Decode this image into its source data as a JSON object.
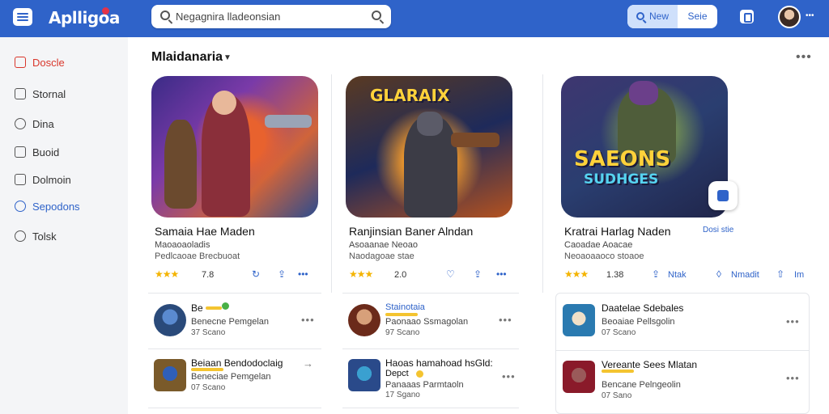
{
  "app": {
    "logo": "Aplligoa",
    "search_placeholder": "Negagnira lladeonsian",
    "new_label": "New",
    "sort_label": "Seie"
  },
  "sidebar": {
    "items": [
      {
        "label": "Doscle",
        "state": "active",
        "icon": "home-icon"
      },
      {
        "label": "Stornal",
        "state": "normal",
        "icon": "store-icon"
      },
      {
        "label": "Dina",
        "state": "normal",
        "icon": "chat-icon"
      },
      {
        "label": "Buoid",
        "state": "normal",
        "icon": "device-icon"
      },
      {
        "label": "Dolmoin",
        "state": "normal",
        "icon": "library-icon"
      },
      {
        "label": "Sepodons",
        "state": "highlight",
        "icon": "compass-icon"
      },
      {
        "label": "Tolsk",
        "state": "normal",
        "icon": "help-icon"
      }
    ]
  },
  "main": {
    "heading": "Mlaidanaria",
    "featured": [
      {
        "title": "Samaia Hae Maden",
        "line1": "Maoaoaoladis",
        "line2": "Pedlcaoae Brecbuoat",
        "stars": "★★★",
        "rating": "7.8",
        "art_text": "",
        "actions": []
      },
      {
        "title": "Ranjinsian Baner Alndan",
        "line1": "Asoaanae Neoao",
        "line2": "Naodagoae stae",
        "stars": "★★★",
        "rating": "2.0",
        "art_text": "GLARAIX",
        "actions": []
      },
      {
        "title": "Kratrai Harlag Naden",
        "line1": "Caoadae Aoacae",
        "line2": "Neoaoaaoco stoaoe",
        "stars": "★★★",
        "rating": "1.38",
        "art_text": "SAEONS",
        "art_subtext": "SUDHGES",
        "actions": [
          "Ntak",
          "Nmadit",
          "Im"
        ],
        "play_label": "Dosi stie"
      }
    ],
    "list": {
      "col1": [
        {
          "title": "Be",
          "line1": "Benecne Pemgelan",
          "line2": "37 Scano"
        },
        {
          "title": "Beiaan Bendodoclaig",
          "line1": "Beneciae Pemgelan",
          "line2": "07 Scano"
        }
      ],
      "col2": [
        {
          "title": "Stainotaia",
          "line1": "Paonaao Ssmagolan",
          "line2": "97 Scano"
        },
        {
          "title": "Haoas hamahoad hsGld:",
          "line1": "Panaaas Parmtaoln",
          "line2": "17 Sgano",
          "badge": "Depct"
        }
      ],
      "col3": [
        {
          "title": "Daatelae Sdebales",
          "line1": "Beoaiae Pellsgolin",
          "line2": "07 Scano"
        },
        {
          "title": "Vereante Sees Mlatan",
          "line1": "Bencane Pelngeolin",
          "line2": "07 Sano"
        }
      ]
    }
  },
  "colors": {
    "accent": "#2f63c9",
    "active": "#d9362b",
    "star": "#f4b400"
  }
}
